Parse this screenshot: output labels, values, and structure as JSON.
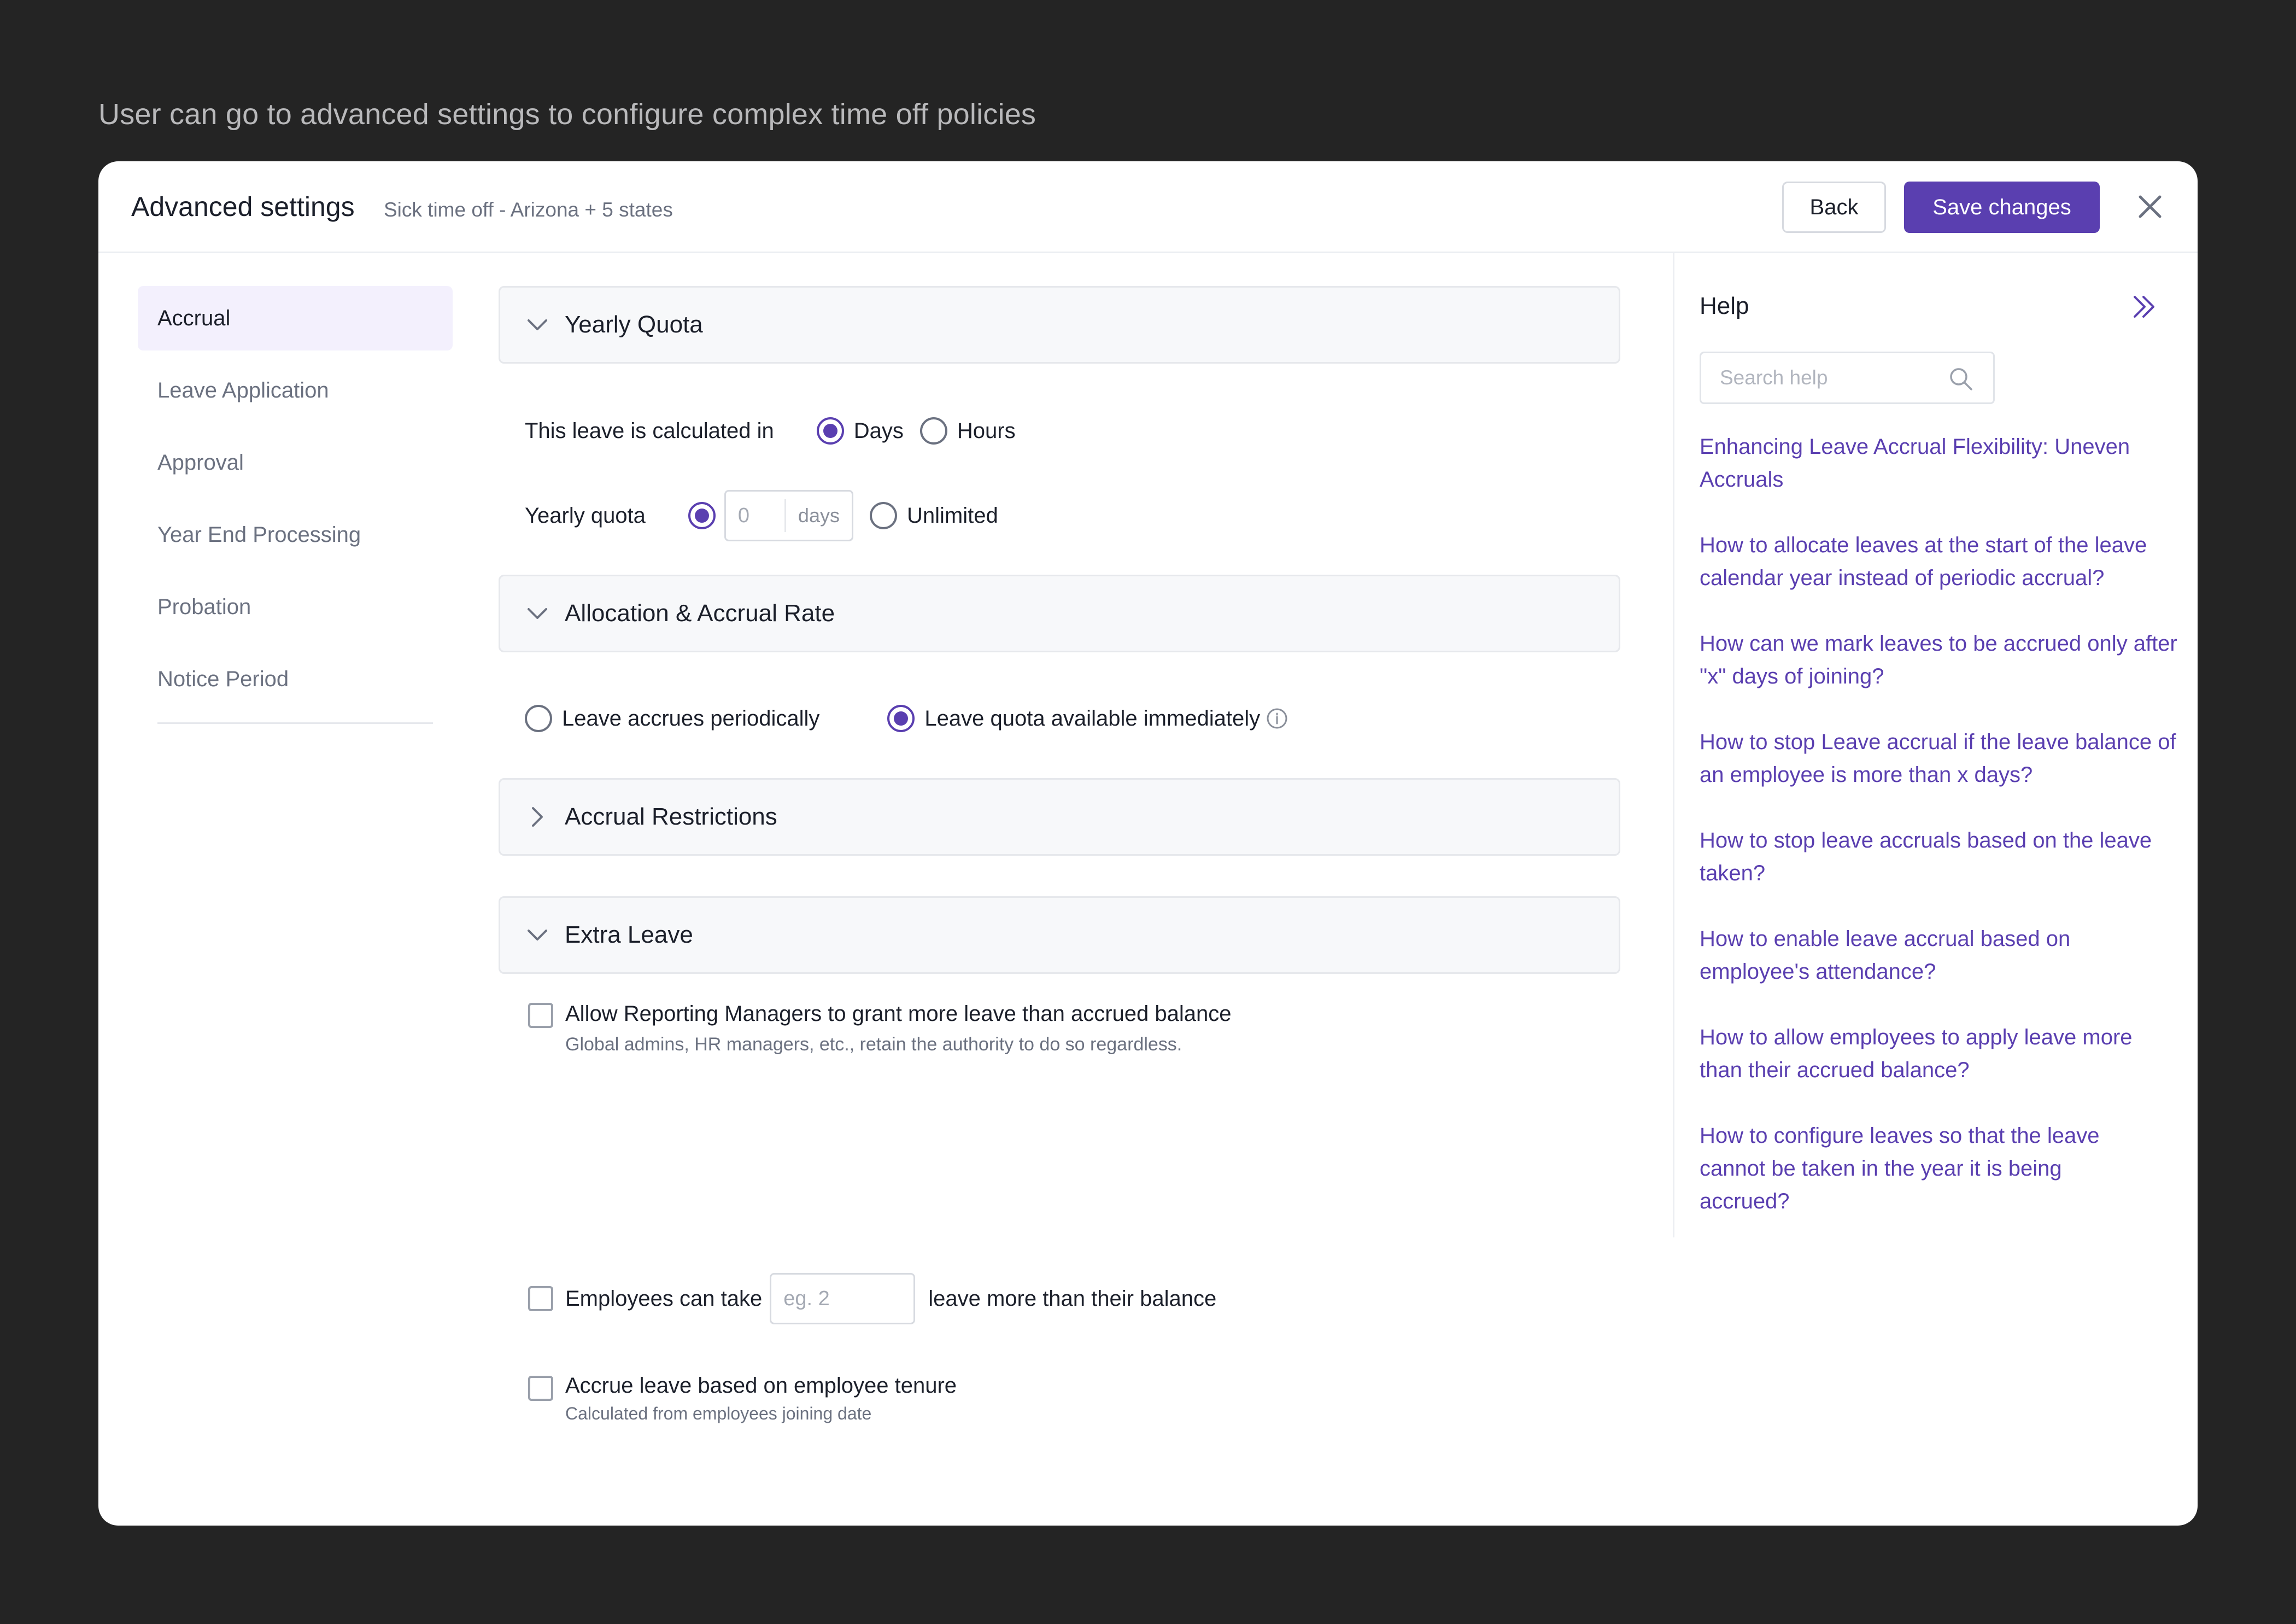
{
  "caption": "User can go to advanced settings to configure complex time off policies",
  "header": {
    "title": "Advanced settings",
    "subtitle": "Sick time off - Arizona + 5 states",
    "back_label": "Back",
    "save_label": "Save changes",
    "close_icon": "close-icon"
  },
  "nav": {
    "items": [
      {
        "label": "Accrual",
        "active": true
      },
      {
        "label": "Leave Application",
        "active": false
      },
      {
        "label": "Approval",
        "active": false
      },
      {
        "label": "Year End Processing",
        "active": false
      },
      {
        "label": "Probation",
        "active": false
      },
      {
        "label": "Notice Period",
        "active": false
      }
    ]
  },
  "sections": {
    "yearly_quota": {
      "title": "Yearly Quota",
      "expanded": true,
      "calc_label": "This leave is calculated in",
      "unit_options": [
        "Days",
        "Hours"
      ],
      "unit_selected": "Days",
      "quota_label": "Yearly quota",
      "quota_value_placeholder": "0",
      "quota_unit": "days",
      "unlimited_label": "Unlimited",
      "quota_mode": "value"
    },
    "allocation": {
      "title": "Allocation & Accrual Rate",
      "expanded": true,
      "options": [
        "Leave accrues periodically",
        "Leave quota available immediately"
      ],
      "selected": "Leave quota available immediately",
      "info_icon": "info-icon"
    },
    "restrictions": {
      "title": "Accrual Restrictions",
      "expanded": false
    },
    "extra_leave": {
      "title": "Extra Leave",
      "expanded": true,
      "grant_label": "Allow Reporting Managers to grant more leave than accrued balance",
      "grant_desc": "Global admins, HR managers, etc., retain the authority to do so regardless.",
      "grant_checked": false,
      "take_prefix": "Employees can take",
      "take_placeholder": "eg. 2",
      "take_suffix": "leave more than their balance",
      "take_checked": false,
      "tenure_label": "Accrue leave based on employee tenure",
      "tenure_desc": "Calculated from employees joining date",
      "tenure_checked": false
    }
  },
  "help": {
    "title": "Help",
    "search_placeholder": "Search help",
    "links": [
      "Enhancing Leave Accrual Flexibility: Uneven Accruals",
      "How to allocate leaves at the start of the leave calendar year instead of periodic accrual?",
      "How can we mark leaves to be accrued only after \"x\" days of joining?",
      "How to stop Leave accrual if the leave balance of an employee is more than x days?",
      "How to stop leave accruals based on the leave taken?",
      "How to enable leave accrual based on employee's attendance?",
      "How to allow employees to apply leave more than their accrued balance?",
      "How to configure leaves so that the leave cannot be taken in the year it is being accrued?"
    ]
  },
  "colors": {
    "accent": "#5a3fb0",
    "backdrop": "#242424",
    "nav_active_bg": "#f3f0fd"
  }
}
